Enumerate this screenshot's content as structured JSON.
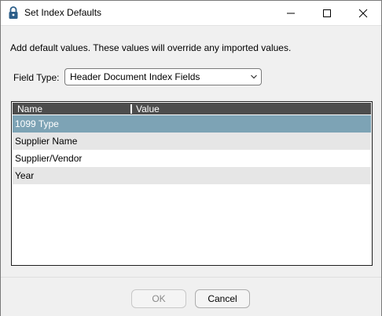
{
  "window": {
    "title": "Set Index Defaults",
    "controls": {
      "minimize": "minimize-icon",
      "maximize": "maximize-icon",
      "close": "close-icon"
    }
  },
  "description": "Add default values. These values will override any imported values.",
  "field_type": {
    "label": "Field Type:",
    "selected": "Header Document Index Fields"
  },
  "grid": {
    "columns": [
      "Name",
      "Value"
    ],
    "rows": [
      {
        "name": "1099 Type",
        "value": "",
        "selected": true
      },
      {
        "name": "Supplier Name",
        "value": "",
        "selected": false
      },
      {
        "name": "Supplier/Vendor",
        "value": "",
        "selected": false
      },
      {
        "name": "Year",
        "value": "",
        "selected": false
      }
    ],
    "colors": {
      "header": "#4d4d4d",
      "selected": "#7da3b5",
      "alt_row": "#e6e6e6"
    }
  },
  "buttons": {
    "ok": "OK",
    "cancel": "Cancel"
  }
}
